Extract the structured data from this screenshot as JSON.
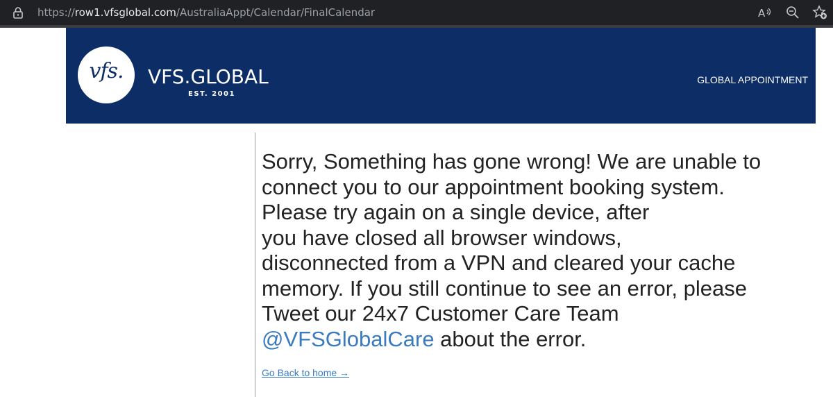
{
  "browser": {
    "url_prefix": "https://",
    "url_host": "row1.vfsglobal.com",
    "url_path": "/AustraliaAppt/Calendar/FinalCalendar",
    "icons": [
      "lock-icon",
      "read-aloud-icon",
      "zoom-icon",
      "favorites-add-icon"
    ],
    "read_aloud_label": "A"
  },
  "header": {
    "logo_mark": "vfs.",
    "logo_name": "VFS.GLOBAL",
    "logo_est": "EST. 2001",
    "nav_label": "GLOBAL APPOINTMENT",
    "bg_color": "#0d2d66"
  },
  "main": {
    "lines": [
      "Sorry, Something has gone wrong! We are unable to",
      "connect you to our appointment booking system.",
      "Please try again on a single device, after",
      "you have closed all browser windows,",
      "disconnected from a VPN and cleared your cache",
      "memory. If you still continue to see an error, please",
      "Tweet our 24x7 Customer Care Team"
    ],
    "twitter_handle": "@VFSGlobalCare",
    "last_line_rest": " about the error.",
    "home_link": "Go Back to home →",
    "link_color": "#3a7bbf"
  }
}
